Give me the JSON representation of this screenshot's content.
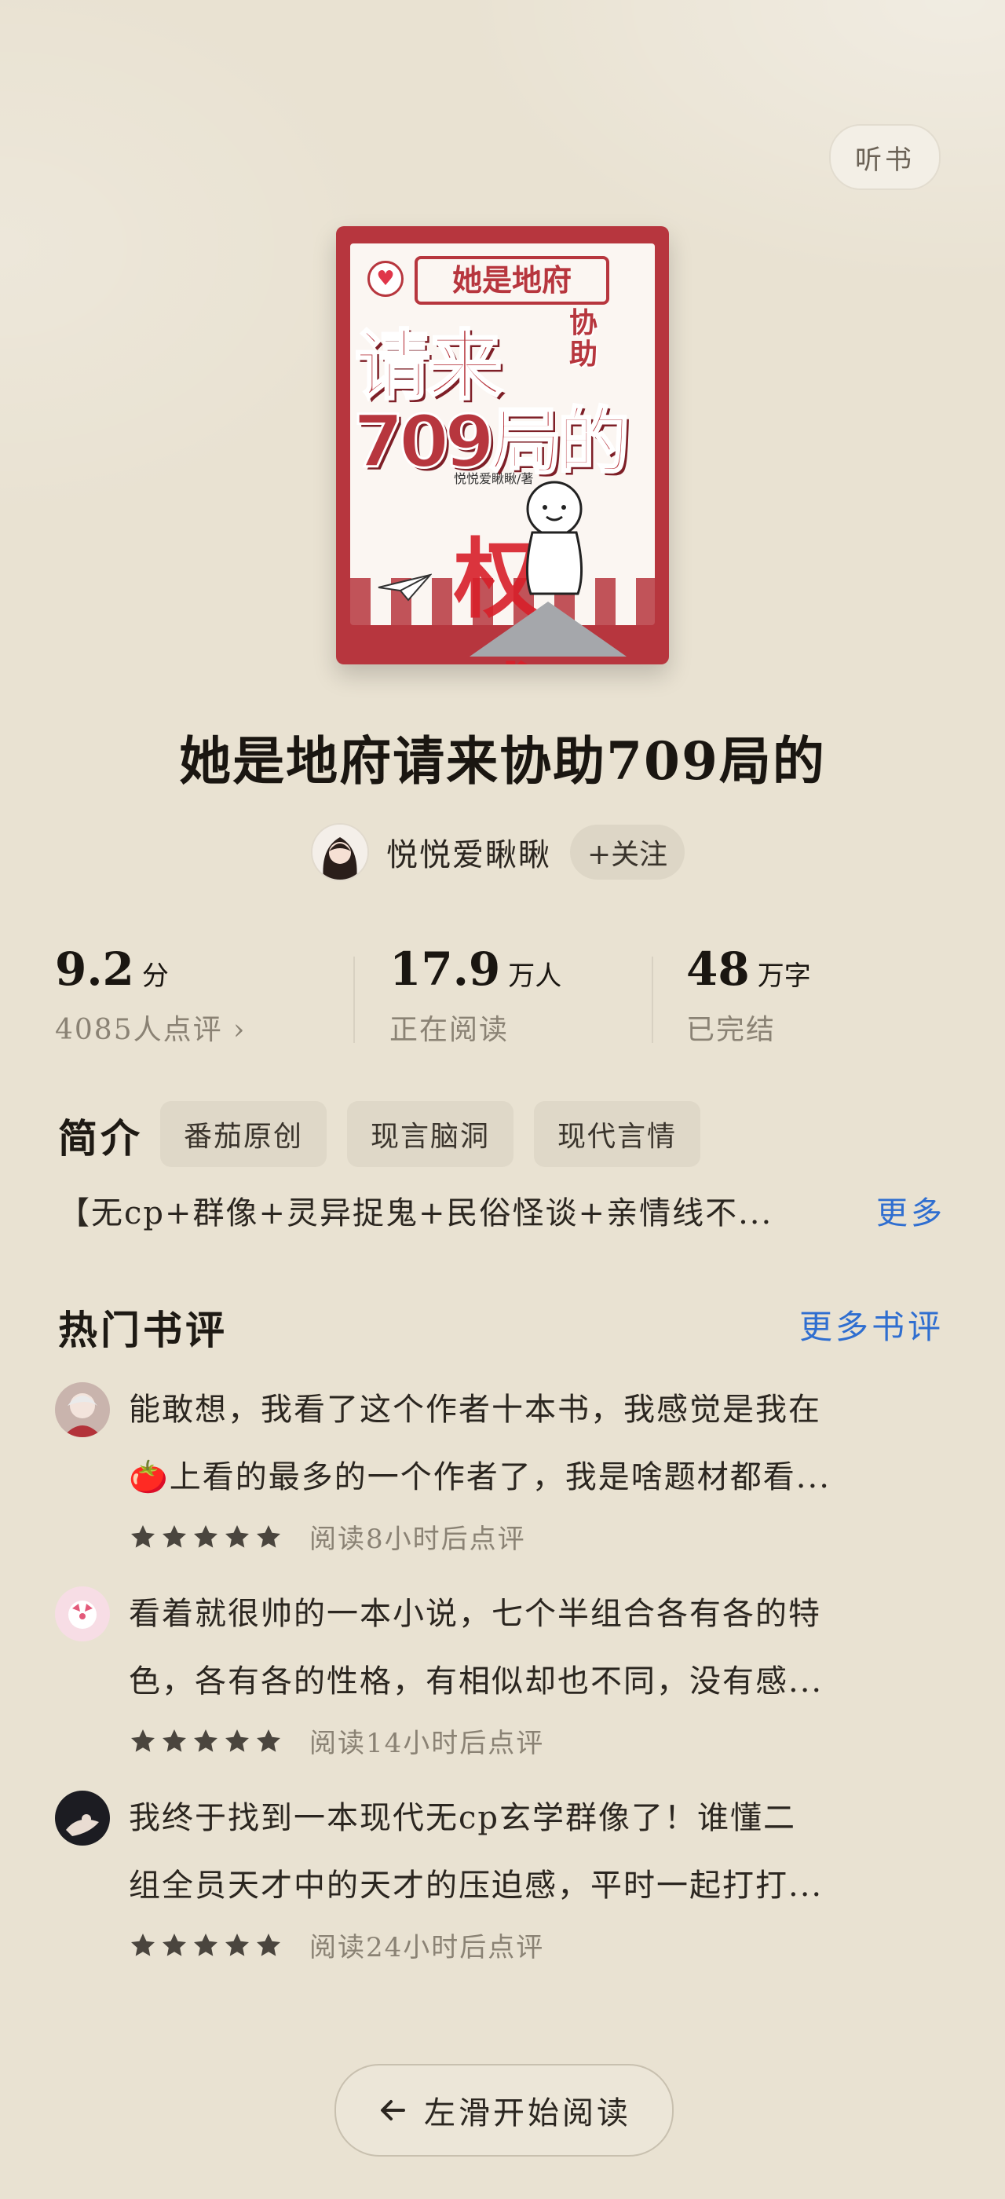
{
  "header": {
    "listen_label": "听书"
  },
  "book": {
    "cover_badge": "她是地府",
    "cover_line1": "请来",
    "cover_small": "协助",
    "cover_line2": "709局的",
    "cover_author": "悦悦爱瞅瞅/著",
    "cover_word": "权威",
    "title": "她是地府请来协助709局的",
    "author": "悦悦爱瞅瞅",
    "follow_label": "+关注"
  },
  "stats": [
    {
      "value": "9.2",
      "unit": "分",
      "sub": "4085人点评 ›"
    },
    {
      "value": "17.9",
      "unit": "万人",
      "sub": "正在阅读"
    },
    {
      "value": "48",
      "unit": "万字",
      "sub": "已完结"
    }
  ],
  "intro": {
    "label": "简介",
    "tags": [
      "番茄原创",
      "现言脑洞",
      "现代言情"
    ],
    "text": "【无cp+群像+灵异捉鬼+民俗怪谈+亲情线不...",
    "more_label": "更多"
  },
  "reviews": {
    "title": "热门书评",
    "more_label": "更多书评",
    "items": [
      {
        "line1": "能敢想，我看了这个作者十本书，我感觉是我在",
        "line2": "🍅上看的最多的一个作者了，我是啥题材都看...",
        "rating": 5,
        "meta": "阅读8小时后点评"
      },
      {
        "line1": "看着就很帅的一本小说，七个半组合各有各的特",
        "line2": "色，各有各的性格，有相似却也不同，没有感...",
        "rating": 5,
        "meta": "阅读14小时后点评"
      },
      {
        "line1": "我终于找到一本现代无cp玄学群像了！谁懂二",
        "line2": "组全员天才中的天才的压迫感，平时一起打打...",
        "rating": 5,
        "meta": "阅读24小时后点评"
      }
    ]
  },
  "footer": {
    "start_label": "左滑开始阅读"
  },
  "colors": {
    "accent_blue": "#2f6ed0",
    "cover_red": "#b7363e",
    "background": "#e9e2d2"
  }
}
